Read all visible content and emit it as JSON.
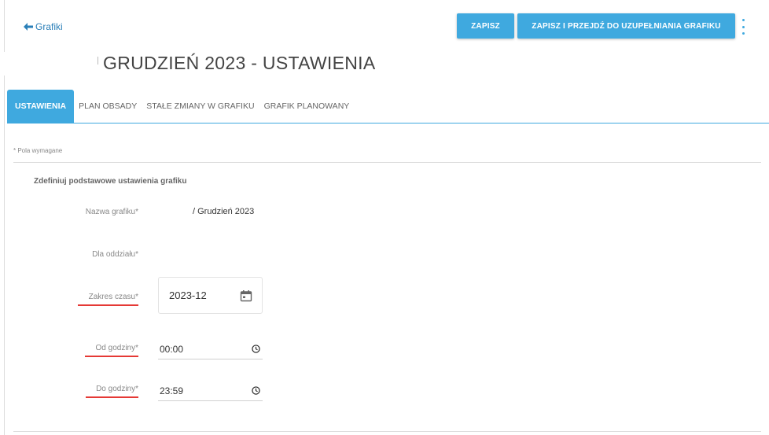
{
  "header": {
    "back_label": "Grafiki",
    "save_label": "ZAPISZ",
    "save_next_label": "ZAPISZ I PRZEJDŹ DO UZUPEŁNIANIA GRAFIKU",
    "page_title": "GRUDZIEŃ 2023 - USTAWIENIA"
  },
  "tabs": [
    {
      "label": "USTAWIENIA",
      "active": true
    },
    {
      "label": "PLAN OBSADY",
      "active": false
    },
    {
      "label": "STAŁE ZMIANY W GRAFIKU",
      "active": false
    },
    {
      "label": "GRAFIK PLANOWANY",
      "active": false
    }
  ],
  "form": {
    "required_note": "* Pola wymagane",
    "section_title": "Zdefiniuj podstawowe ustawienia grafiku",
    "name_label": "Nazwa grafiku*",
    "name_value": "/ Grudzień 2023",
    "dept_label": "Dla oddziału*",
    "range_label": "Zakres czasu*",
    "range_value": "2023-12",
    "from_label": "Od godziny*",
    "from_value": "00:00",
    "to_label": "Do godziny*",
    "to_value": "23:59"
  },
  "icons": {
    "back": "arrow-left-icon",
    "menu": "kebab-menu-icon",
    "calendar": "calendar-icon",
    "clock": "clock-icon"
  },
  "colors": {
    "accent": "#3fa9df",
    "link": "#2a7fb8",
    "error": "#e53935"
  }
}
